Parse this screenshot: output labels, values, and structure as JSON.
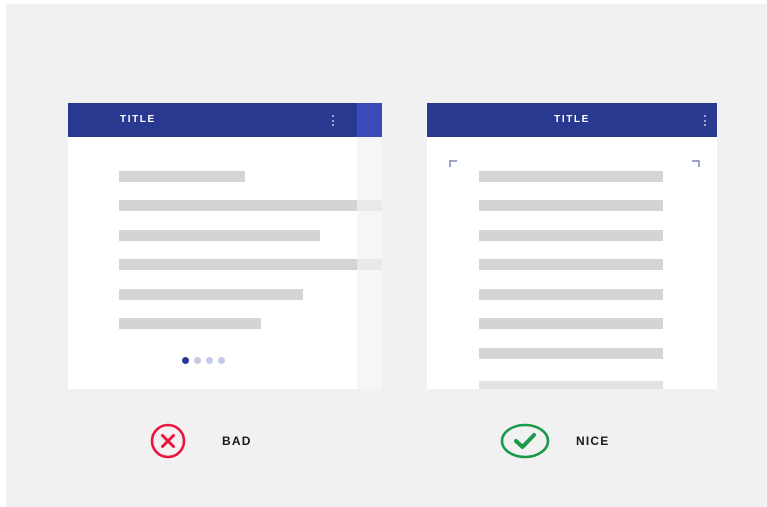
{
  "bad_example": {
    "title": "TITLE",
    "indicator_dots": 4,
    "active_dot": 0,
    "verdict_label": "BAD",
    "verdict_icon": "cross-circle-icon",
    "verdict_color": "#e8173b"
  },
  "nice_example": {
    "title": "TITLE",
    "verdict_label": "NICE",
    "verdict_icon": "check-circle-icon",
    "verdict_color": "#1a9a4a"
  },
  "colors": {
    "app_bar": "#2a3990",
    "background": "#f1f1f1",
    "content_line": "#d4d4d4"
  }
}
